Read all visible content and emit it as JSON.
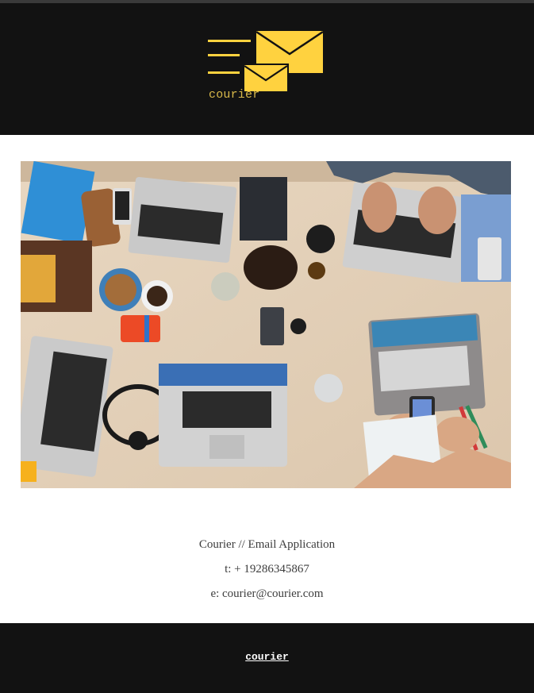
{
  "brand": {
    "name": "courier",
    "accent_color": "#FFD23F",
    "logo_icon": "envelope-icon"
  },
  "hero": {
    "alt": "Team working with laptops and phones on a wooden desk"
  },
  "contact": {
    "title": "Courier // Email Application",
    "phone": "t: + 19286345867",
    "email": "e: courier@courier.com"
  },
  "footer": {
    "link_label": "courier"
  },
  "colors": {
    "header_bg": "#121212",
    "footer_bg": "#121212",
    "text": "#3d3d3d"
  }
}
